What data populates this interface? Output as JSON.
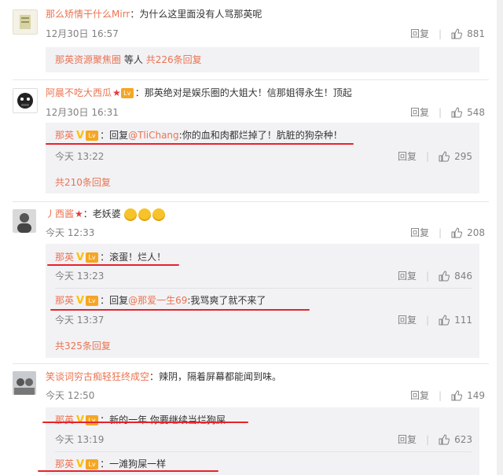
{
  "comments": [
    {
      "user": "那么矫情干什么Mirr",
      "text": "：为什么这里面没有人骂那英呢",
      "time": "12月30日 16:57",
      "reply_label": "回复",
      "likes": "881",
      "summary_user": "那英资源聚焦圈",
      "summary_mid": "等人",
      "summary_count": "共226条回复"
    },
    {
      "user": "阿晨不吃大西瓜",
      "text": "：那英绝对是娱乐圈的大姐大！信那姐得永生！顶起",
      "time": "12月30日 16:31",
      "reply_label": "回复",
      "likes": "548",
      "sub": {
        "user": "那英",
        "prefix": "：回复",
        "mention": "@TliChang",
        "text": ":你的血和肉都烂掉了！肮脏的狗杂种！",
        "time": "今天 13:22",
        "reply_label": "回复",
        "likes": "295"
      },
      "more": "共210条回复"
    },
    {
      "user": "丿西酱",
      "text": "：老妖婆",
      "time": "今天 12:33",
      "reply_label": "回复",
      "likes": "208",
      "sub1": {
        "user": "那英",
        "text": "：滚蛋！烂人！",
        "time": "今天 13:23",
        "reply_label": "回复",
        "likes": "846"
      },
      "sub2": {
        "user": "那英",
        "prefix": "：回复",
        "mention": "@那爱一生69",
        "text": ":我骂爽了就不来了",
        "time": "今天 13:37",
        "reply_label": "回复",
        "likes": "111"
      },
      "more": "共325条回复"
    },
    {
      "user": "笑谈词穷古痴轻狂终成空",
      "text": "：辣阴，隔着屏幕都能闻到味。",
      "time": "今天 12:50",
      "reply_label": "回复",
      "likes": "149",
      "sub1": {
        "user": "那英",
        "text": "：新的一年 你要继续当烂狗屎",
        "time": "今天 13:19",
        "reply_label": "回复",
        "likes": "623"
      },
      "sub2": {
        "user": "那英",
        "text": "：一滩狗屎一样"
      }
    }
  ],
  "badge_vip": "V",
  "badge_level": "Lv",
  "colors": {
    "link": "#eb7350",
    "underline": "#e8222b",
    "subbg": "#f2f2f5"
  }
}
